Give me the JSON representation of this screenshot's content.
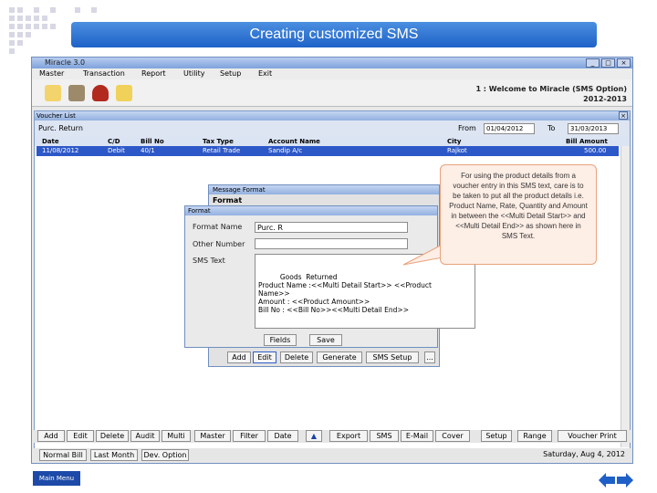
{
  "slide": {
    "title": "Creating customized SMS",
    "main_menu": "Main Menu"
  },
  "app": {
    "title": "Miracle 3.0",
    "menu": [
      "Master",
      "Transaction",
      "Report",
      "Utility",
      "Setup",
      "Exit"
    ],
    "welcome_line1": "1 : Welcome to Miracle (SMS Option)",
    "welcome_line2": "2012-2013"
  },
  "voucher_list": {
    "title": "Voucher List",
    "type_label": "Purc. Return",
    "from_label": "From",
    "from_value": "01/04/2012",
    "to_label": "To",
    "to_value": "31/03/2013",
    "columns": [
      "Date",
      "C/D",
      "Bill No",
      "Tax Type",
      "Account Name",
      "City",
      "Bill Amount"
    ],
    "row": [
      "11/08/2012",
      "Debit",
      "40/1",
      "Retail Trade",
      "Sandip A/c",
      "Rajkot",
      "500.00"
    ]
  },
  "message_format": {
    "title": "Message Format",
    "tab": "Format"
  },
  "format_dialog": {
    "title": "Format",
    "format_name_label": "Format Name",
    "format_name_value": "Purc. R",
    "other_number_label": "Other Number",
    "sms_text_label": "SMS Text",
    "sms_text": "          Goods  Returned\nProduct Name :<<Multi Detail Start>> <<Product\nName>>\nAmount : <<Product Amount>>\nBill No : <<Bill No>><<Multi Detail End>>",
    "fields_button": "Fields",
    "save_button": "Save"
  },
  "format_buttons": [
    "Add",
    "Edit",
    "Delete",
    "Generate",
    "SMS Setup",
    "..."
  ],
  "callout_text": "For using the product details from a voucher entry in this SMS text, care is to be taken to put all the product details i.e. Product Name, Rate, Quantity and Amount in between the <<Multi Detail Start>> and <<Multi Detail End>> as shown here in SMS Text.",
  "bottom_buttons": [
    "Add",
    "Edit",
    "Delete",
    "Audit",
    "Multi",
    "Master",
    "Filter",
    "Date",
    "Export",
    "SMS",
    "E-Mail",
    "Cover",
    "Setup",
    "Range",
    "Voucher Print"
  ],
  "status_bar": {
    "tabs": [
      "Normal Bill",
      "Last Month",
      "Dev. Option"
    ],
    "date": "Saturday, Aug 4, 2012"
  },
  "colors": {
    "slide_title_bg": "#2a6fd6",
    "selected_row": "#2d58c8",
    "callout_bg": "#fdeee6"
  }
}
